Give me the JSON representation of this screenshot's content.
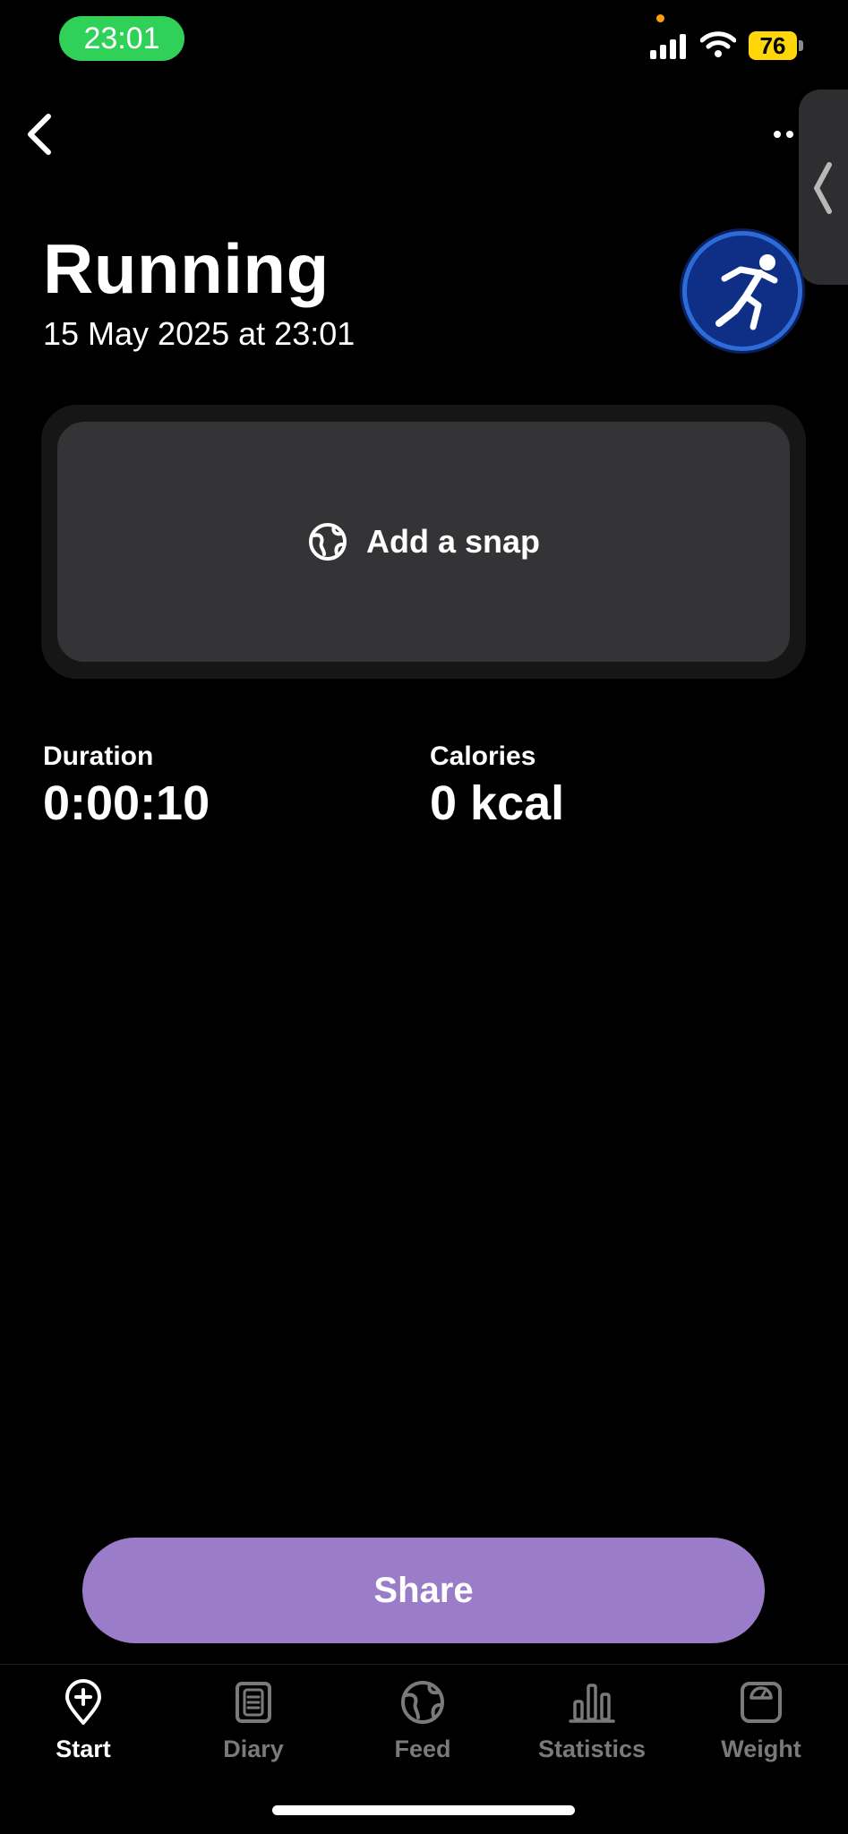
{
  "status_bar": {
    "time": "23:01",
    "battery": "76"
  },
  "activity": {
    "title": "Running",
    "datetime": "15 May 2025 at 23:01"
  },
  "snap": {
    "label": "Add a snap"
  },
  "stats": [
    {
      "label": "Duration",
      "value": "0:00:10"
    },
    {
      "label": "Calories",
      "value": "0 kcal"
    }
  ],
  "share": {
    "label": "Share"
  },
  "tabs": [
    {
      "label": "Start",
      "icon": "pin-plus-icon",
      "active": true
    },
    {
      "label": "Diary",
      "icon": "diary-icon",
      "active": false
    },
    {
      "label": "Feed",
      "icon": "globe-icon",
      "active": false
    },
    {
      "label": "Statistics",
      "icon": "bar-chart-icon",
      "active": false
    },
    {
      "label": "Weight",
      "icon": "scale-icon",
      "active": false
    }
  ],
  "colors": {
    "accent": "#9b7cc9",
    "time_pill": "#30d158",
    "battery": "#ffd60a",
    "avatar": "#0f2e86"
  }
}
